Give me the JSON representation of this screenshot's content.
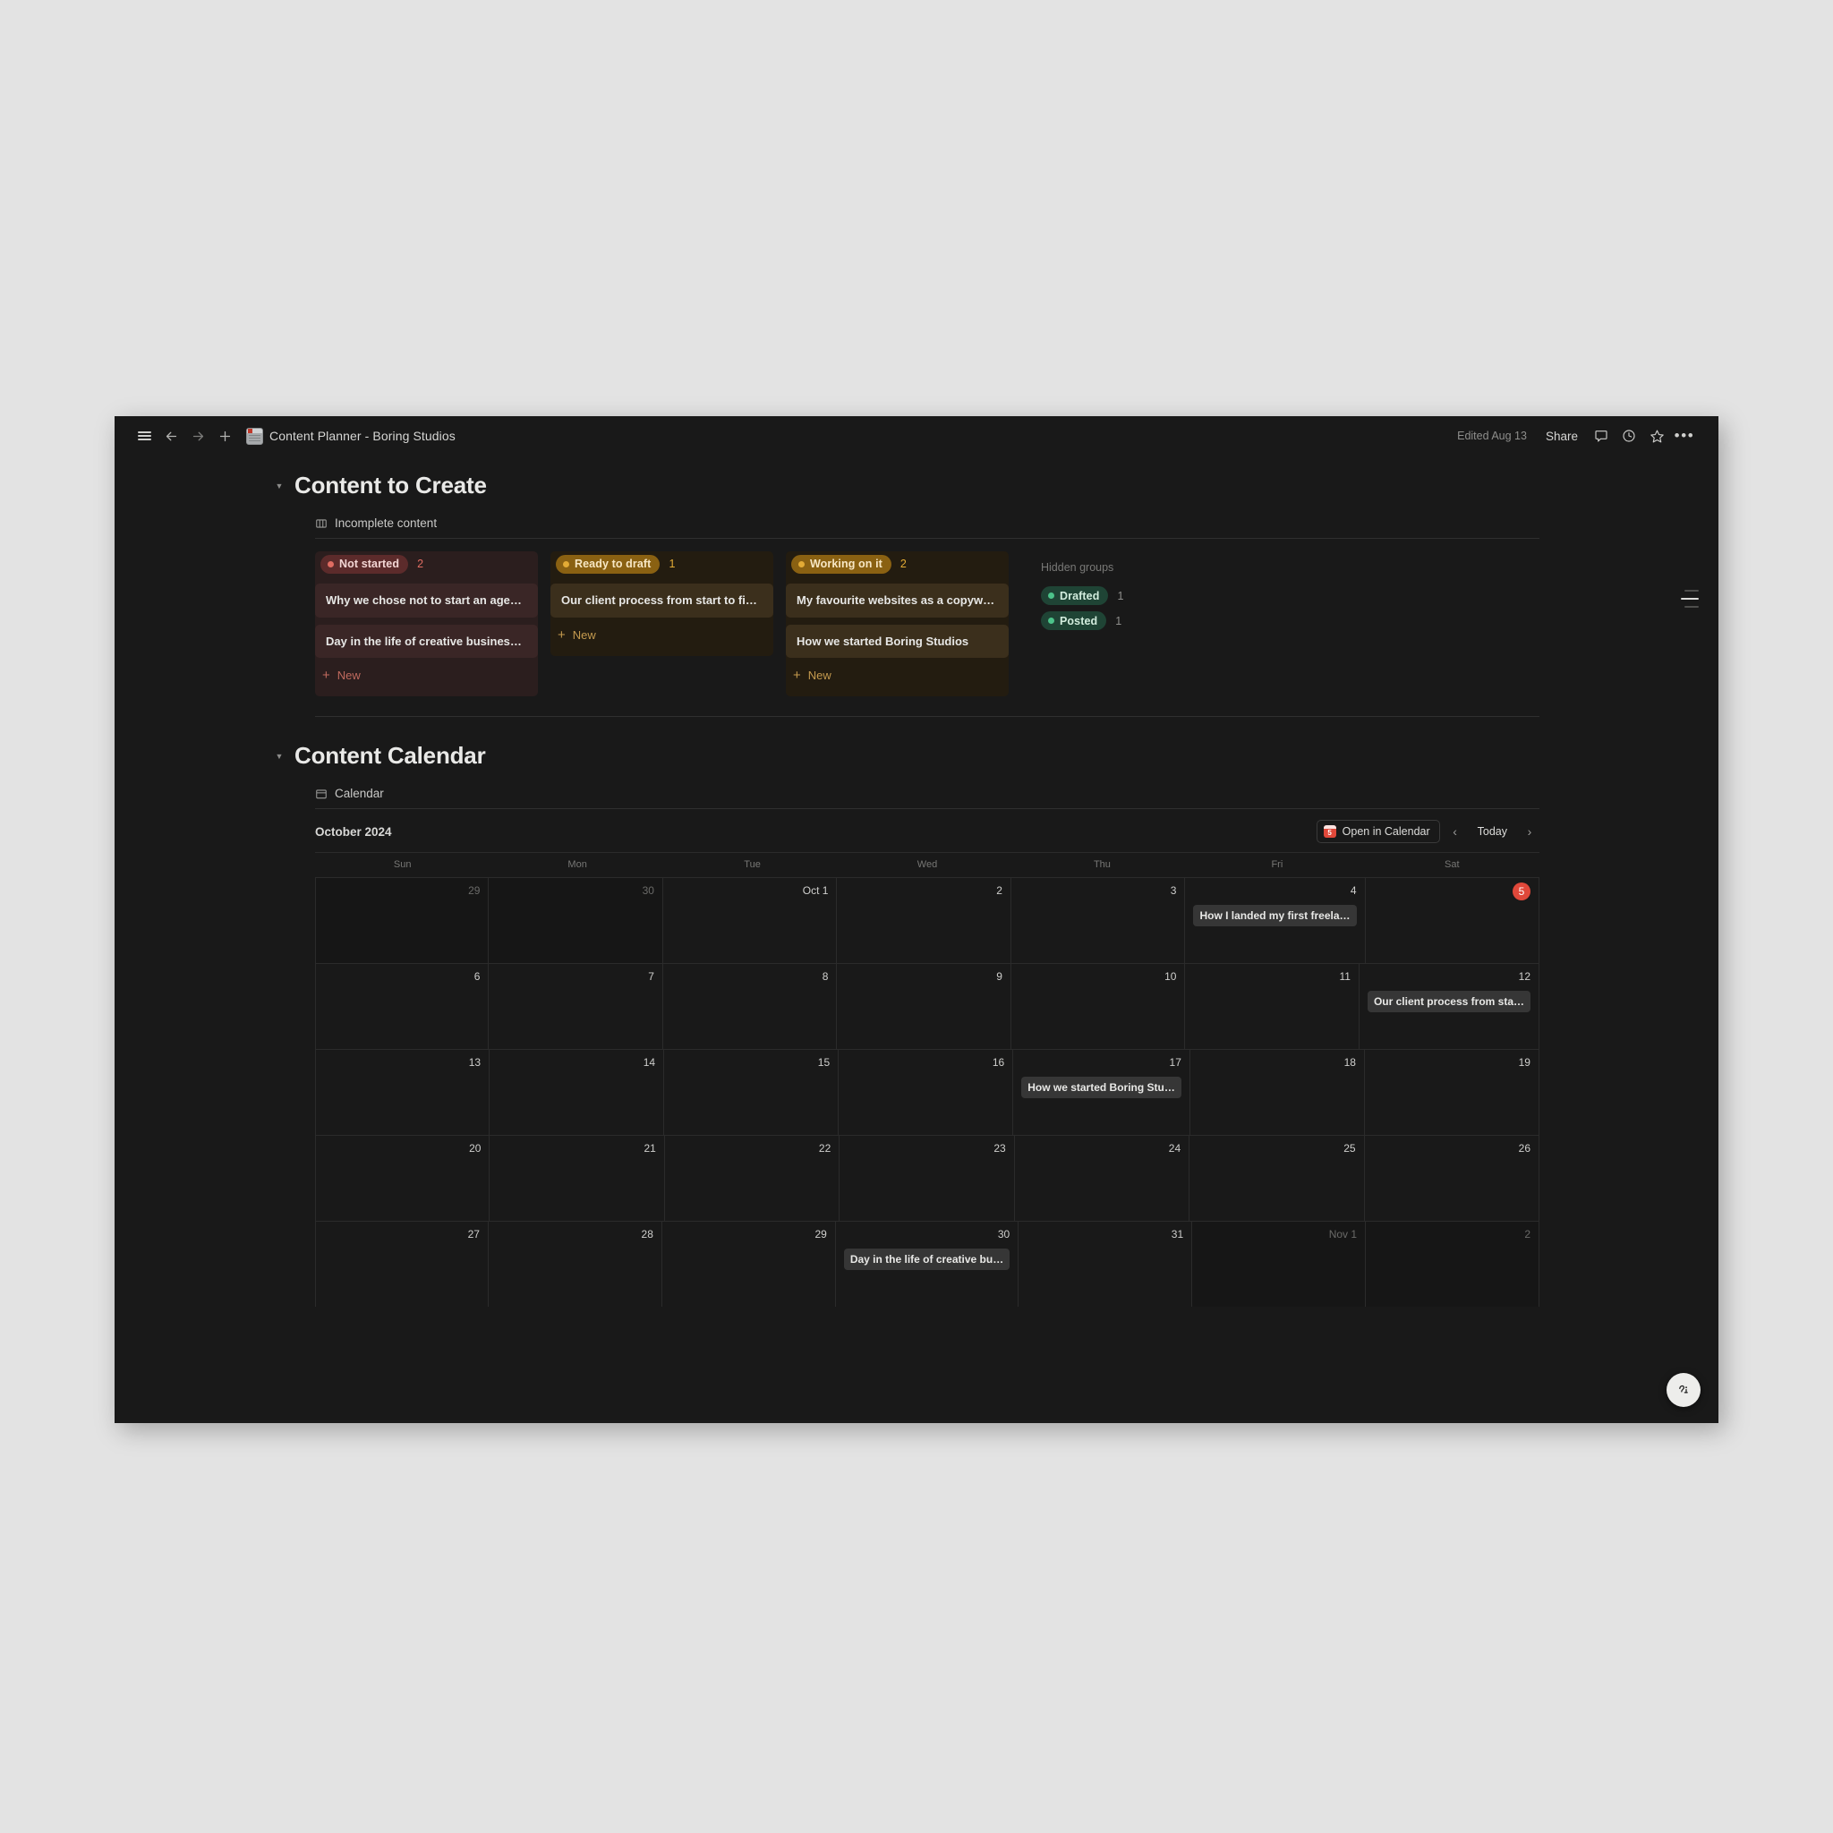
{
  "window": {
    "topbar": {
      "menu_icon": "hamburger-menu-icon",
      "back_icon": "back-arrow-icon",
      "forward_icon": "forward-arrow-icon",
      "new_icon": "plus-icon",
      "page_icon": "page-emoji-icon",
      "page_title": "Content Planner - Boring Studios",
      "edited_label": "Edited Aug 13",
      "share_label": "Share",
      "comment_icon": "comment-icon",
      "history_icon": "clock-history-icon",
      "favorite_icon": "star-icon",
      "more_label": "•••"
    }
  },
  "sections": {
    "content_to_create": {
      "heading": "Content to Create",
      "database_name": "Incomplete content",
      "database_icon": "board-view-icon",
      "columns": [
        {
          "label": "Not started",
          "count": "2",
          "pill_bg": "#5c2b2b",
          "pill_fg": "#f3d6d4",
          "dot": "#e06c62",
          "col_bg": "#2b1e1e",
          "card_bg": "#3a2626",
          "new_label": "New",
          "new_color": "#c06a5e",
          "cards": [
            "Why we chose not to start an agency",
            "Day in the life of creative business owners"
          ]
        },
        {
          "label": "Ready to draft",
          "count": "1",
          "pill_bg": "#8a6112",
          "pill_fg": "#f7e7c4",
          "dot": "#e3ab35",
          "col_bg": "#231c10",
          "card_bg": "#3b2f1c",
          "new_label": "New",
          "new_color": "#c49a4e",
          "cards": [
            "Our client process from start to finish"
          ]
        },
        {
          "label": "Working on it",
          "count": "2",
          "pill_bg": "#8a6112",
          "pill_fg": "#f7e7c4",
          "dot": "#e3ab35",
          "col_bg": "#231c10",
          "card_bg": "#3b2f1c",
          "new_label": "New",
          "new_color": "#c49a4e",
          "cards": [
            "My favourite websites as a copywriter",
            "How we started Boring Studios"
          ]
        }
      ],
      "hidden_groups": {
        "title": "Hidden groups",
        "items": [
          {
            "label": "Drafted",
            "count": "1",
            "pill_bg": "#1f4435",
            "pill_fg": "#d2ecdd",
            "dot": "#4cc38a"
          },
          {
            "label": "Posted",
            "count": "1",
            "pill_bg": "#1f4435",
            "pill_fg": "#d2ecdd",
            "dot": "#4cc38a"
          }
        ]
      }
    },
    "content_calendar": {
      "heading": "Content Calendar",
      "database_name": "Calendar",
      "database_icon": "calendar-view-icon",
      "toolbar": {
        "month_label": "October 2024",
        "open_in_calendar_label": "Open in Calendar",
        "open_in_calendar_icon": "apple-calendar-icon",
        "open_in_calendar_icon_day": "5",
        "prev_label": "‹",
        "today_label": "Today",
        "next_label": "›"
      },
      "day_headers": [
        "Sun",
        "Mon",
        "Tue",
        "Wed",
        "Thu",
        "Fri",
        "Sat"
      ],
      "weeks": [
        [
          {
            "num": "29",
            "out": true,
            "today": false,
            "events": []
          },
          {
            "num": "30",
            "out": true,
            "today": false,
            "events": []
          },
          {
            "num": "Oct 1",
            "out": false,
            "today": false,
            "events": []
          },
          {
            "num": "2",
            "out": false,
            "today": false,
            "events": []
          },
          {
            "num": "3",
            "out": false,
            "today": false,
            "events": []
          },
          {
            "num": "4",
            "out": false,
            "today": false,
            "events": [
              "How I landed my first freela…"
            ]
          },
          {
            "num": "5",
            "out": false,
            "today": true,
            "events": []
          }
        ],
        [
          {
            "num": "6",
            "out": false,
            "today": false,
            "events": []
          },
          {
            "num": "7",
            "out": false,
            "today": false,
            "events": []
          },
          {
            "num": "8",
            "out": false,
            "today": false,
            "events": []
          },
          {
            "num": "9",
            "out": false,
            "today": false,
            "events": []
          },
          {
            "num": "10",
            "out": false,
            "today": false,
            "events": []
          },
          {
            "num": "11",
            "out": false,
            "today": false,
            "events": []
          },
          {
            "num": "12",
            "out": false,
            "today": false,
            "events": [
              "Our client process from sta…"
            ]
          }
        ],
        [
          {
            "num": "13",
            "out": false,
            "today": false,
            "events": []
          },
          {
            "num": "14",
            "out": false,
            "today": false,
            "events": []
          },
          {
            "num": "15",
            "out": false,
            "today": false,
            "events": []
          },
          {
            "num": "16",
            "out": false,
            "today": false,
            "events": []
          },
          {
            "num": "17",
            "out": false,
            "today": false,
            "events": [
              "How we started Boring Stu…"
            ]
          },
          {
            "num": "18",
            "out": false,
            "today": false,
            "events": []
          },
          {
            "num": "19",
            "out": false,
            "today": false,
            "events": []
          }
        ],
        [
          {
            "num": "20",
            "out": false,
            "today": false,
            "events": []
          },
          {
            "num": "21",
            "out": false,
            "today": false,
            "events": []
          },
          {
            "num": "22",
            "out": false,
            "today": false,
            "events": []
          },
          {
            "num": "23",
            "out": false,
            "today": false,
            "events": []
          },
          {
            "num": "24",
            "out": false,
            "today": false,
            "events": []
          },
          {
            "num": "25",
            "out": false,
            "today": false,
            "events": []
          },
          {
            "num": "26",
            "out": false,
            "today": false,
            "events": []
          }
        ],
        [
          {
            "num": "27",
            "out": false,
            "today": false,
            "events": []
          },
          {
            "num": "28",
            "out": false,
            "today": false,
            "events": []
          },
          {
            "num": "29",
            "out": false,
            "today": false,
            "events": []
          },
          {
            "num": "30",
            "out": false,
            "today": false,
            "events": [
              "Day in the life of creative bu…"
            ]
          },
          {
            "num": "31",
            "out": false,
            "today": false,
            "events": []
          },
          {
            "num": "Nov 1",
            "out": true,
            "today": false,
            "events": []
          },
          {
            "num": "2",
            "out": true,
            "today": false,
            "events": []
          }
        ]
      ]
    }
  },
  "floating": {
    "toc_icon": "table-of-contents-icon",
    "assistant_icon": "ai-assistant-face-icon"
  }
}
